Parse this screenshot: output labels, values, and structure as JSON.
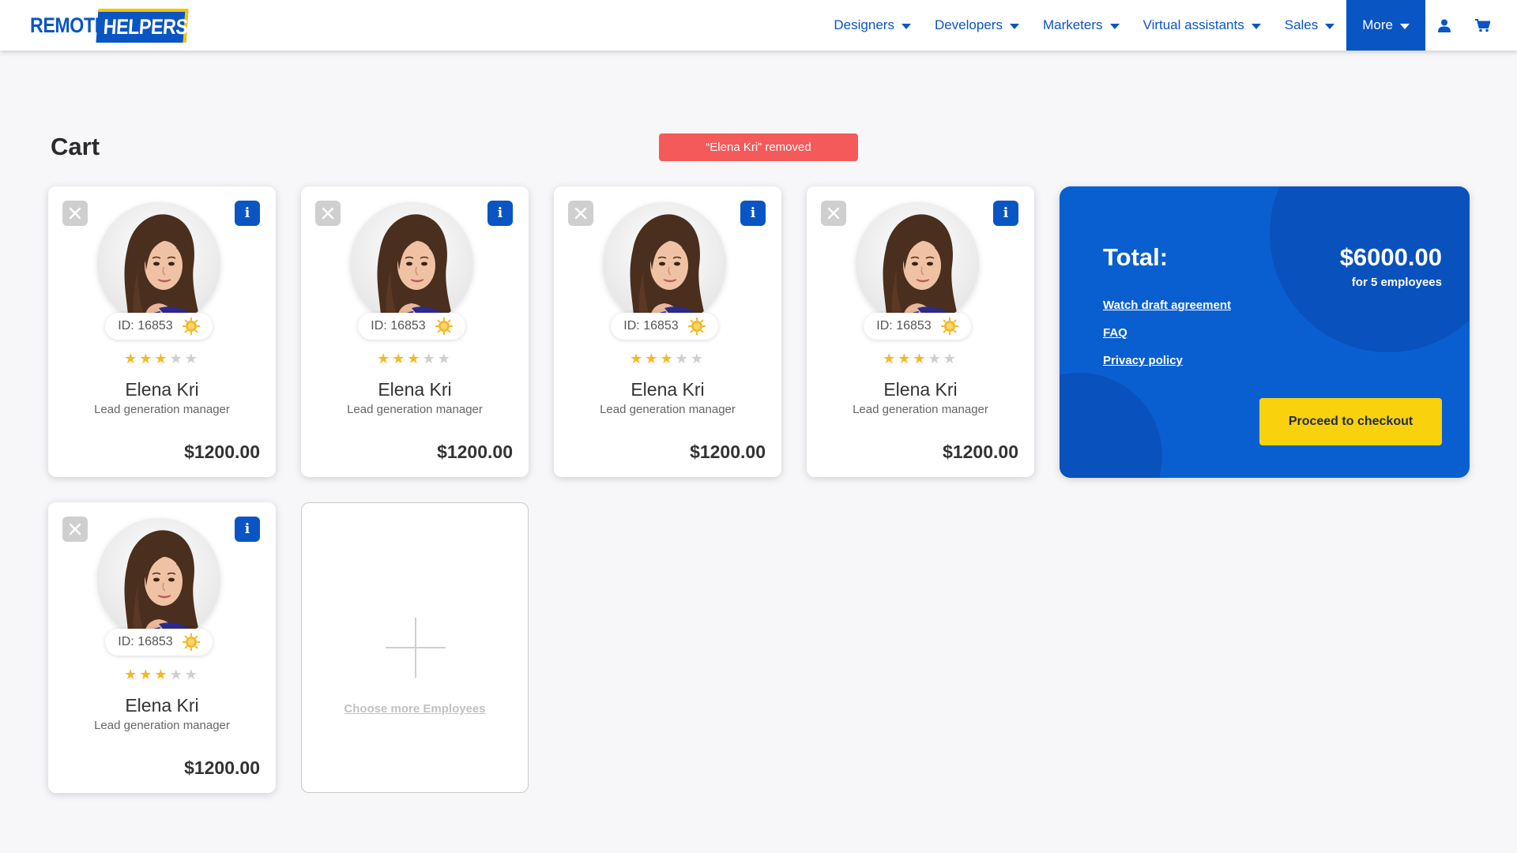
{
  "header": {
    "logo_word1": "REMOTE",
    "logo_word2": "HELPERS",
    "nav": [
      {
        "label": "Designers"
      },
      {
        "label": "Developers"
      },
      {
        "label": "Marketers"
      },
      {
        "label": "Virtual assistants"
      },
      {
        "label": "Sales"
      },
      {
        "label": "More"
      }
    ],
    "icons": [
      "user-icon",
      "cart-icon"
    ]
  },
  "page": {
    "title": "Cart",
    "toast": "“Elena Kri” removed"
  },
  "cart_items": [
    {
      "id_label": "ID: 16853",
      "name": "Elena Kri",
      "role": "Lead generation manager",
      "price": "$1200.00",
      "rating": 3,
      "max_rating": 5
    },
    {
      "id_label": "ID: 16853",
      "name": "Elena Kri",
      "role": "Lead generation manager",
      "price": "$1200.00",
      "rating": 3,
      "max_rating": 5
    },
    {
      "id_label": "ID: 16853",
      "name": "Elena Kri",
      "role": "Lead generation manager",
      "price": "$1200.00",
      "rating": 3,
      "max_rating": 5
    },
    {
      "id_label": "ID: 16853",
      "name": "Elena Kri",
      "role": "Lead generation manager",
      "price": "$1200.00",
      "rating": 3,
      "max_rating": 5
    },
    {
      "id_label": "ID: 16853",
      "name": "Elena Kri",
      "role": "Lead generation manager",
      "price": "$1200.00",
      "rating": 3,
      "max_rating": 5
    }
  ],
  "add_card": {
    "label": "Choose more Employees"
  },
  "summary": {
    "total_label": "Total:",
    "total_amount": "$6000.00",
    "employees_note": "for 5 employees",
    "links": [
      "Watch draft agreement",
      "FAQ",
      "Privacy policy"
    ],
    "checkout_label": "Proceed to checkout"
  },
  "colors": {
    "brand_blue": "#0a55c4",
    "accent_yellow": "#f9d10c",
    "toast_red": "#f55a5a",
    "star_gold": "#f5b829"
  }
}
